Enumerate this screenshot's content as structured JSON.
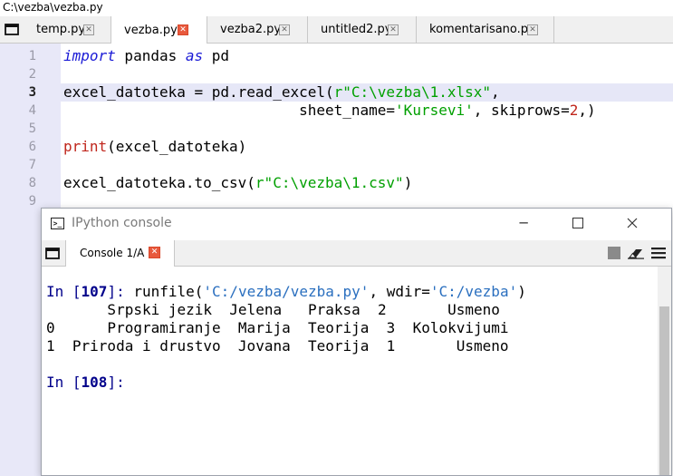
{
  "window": {
    "path": "C:\\vezba\\vezba.py"
  },
  "editor_tabs": [
    {
      "label": "temp.py"
    },
    {
      "label": "vezba.py"
    },
    {
      "label": "vezba2.py"
    },
    {
      "label": "untitled2.py"
    },
    {
      "label": "komentarisano.py"
    }
  ],
  "gutter": {
    "lines": [
      "1",
      "2",
      "3",
      "4",
      "5",
      "6",
      "7",
      "8",
      "9"
    ]
  },
  "code": {
    "l1": {
      "kw1": "import",
      "mid": " pandas ",
      "kw2": "as",
      "end": " pd"
    },
    "l3": {
      "a": "excel_datoteka = pd.read_excel(",
      "s": "r\"C:\\vezba\\1.xlsx\"",
      "b": ","
    },
    "l4": {
      "a": "                           sheet_name=",
      "s": "'Kursevi'",
      "b": ", skiprows=",
      "n": "2",
      "c": ",)"
    },
    "l6": {
      "fn": "print",
      "rest": "(excel_datoteka)"
    },
    "l8": {
      "a": "excel_datoteka.to_csv(",
      "s": "r\"C:\\vezba\\1.csv\"",
      "b": ")"
    }
  },
  "console_window": {
    "title": "IPython console",
    "title_icon": "terminal-icon",
    "tab_label": "Console 1/A"
  },
  "console": {
    "in1": {
      "prefix": "In [",
      "num": "107",
      "suffix": "]:",
      "a": " runfile(",
      "s1": "'C:/vezba/vezba.py'",
      "b": ", wdir=",
      "s2": "'C:/vezba'",
      "c": ")"
    },
    "out_header": "       Srpski jezik  Jelena   Praksa  2       Usmeno",
    "out_row0": "0      Programiranje  Marija  Teorija  3  Kolokvijumi",
    "out_row1": "1  Priroda i drustvo  Jovana  Teorija  1       Usmeno",
    "in2": {
      "prefix": "In [",
      "num": "108",
      "suffix": "]:"
    }
  },
  "colors": {
    "keyword": "#1a1ad6",
    "string": "#00a000",
    "number": "#c0261c",
    "prompt": "#00008b",
    "console_string": "#2a6fbf",
    "close_active": "#e8593d"
  }
}
